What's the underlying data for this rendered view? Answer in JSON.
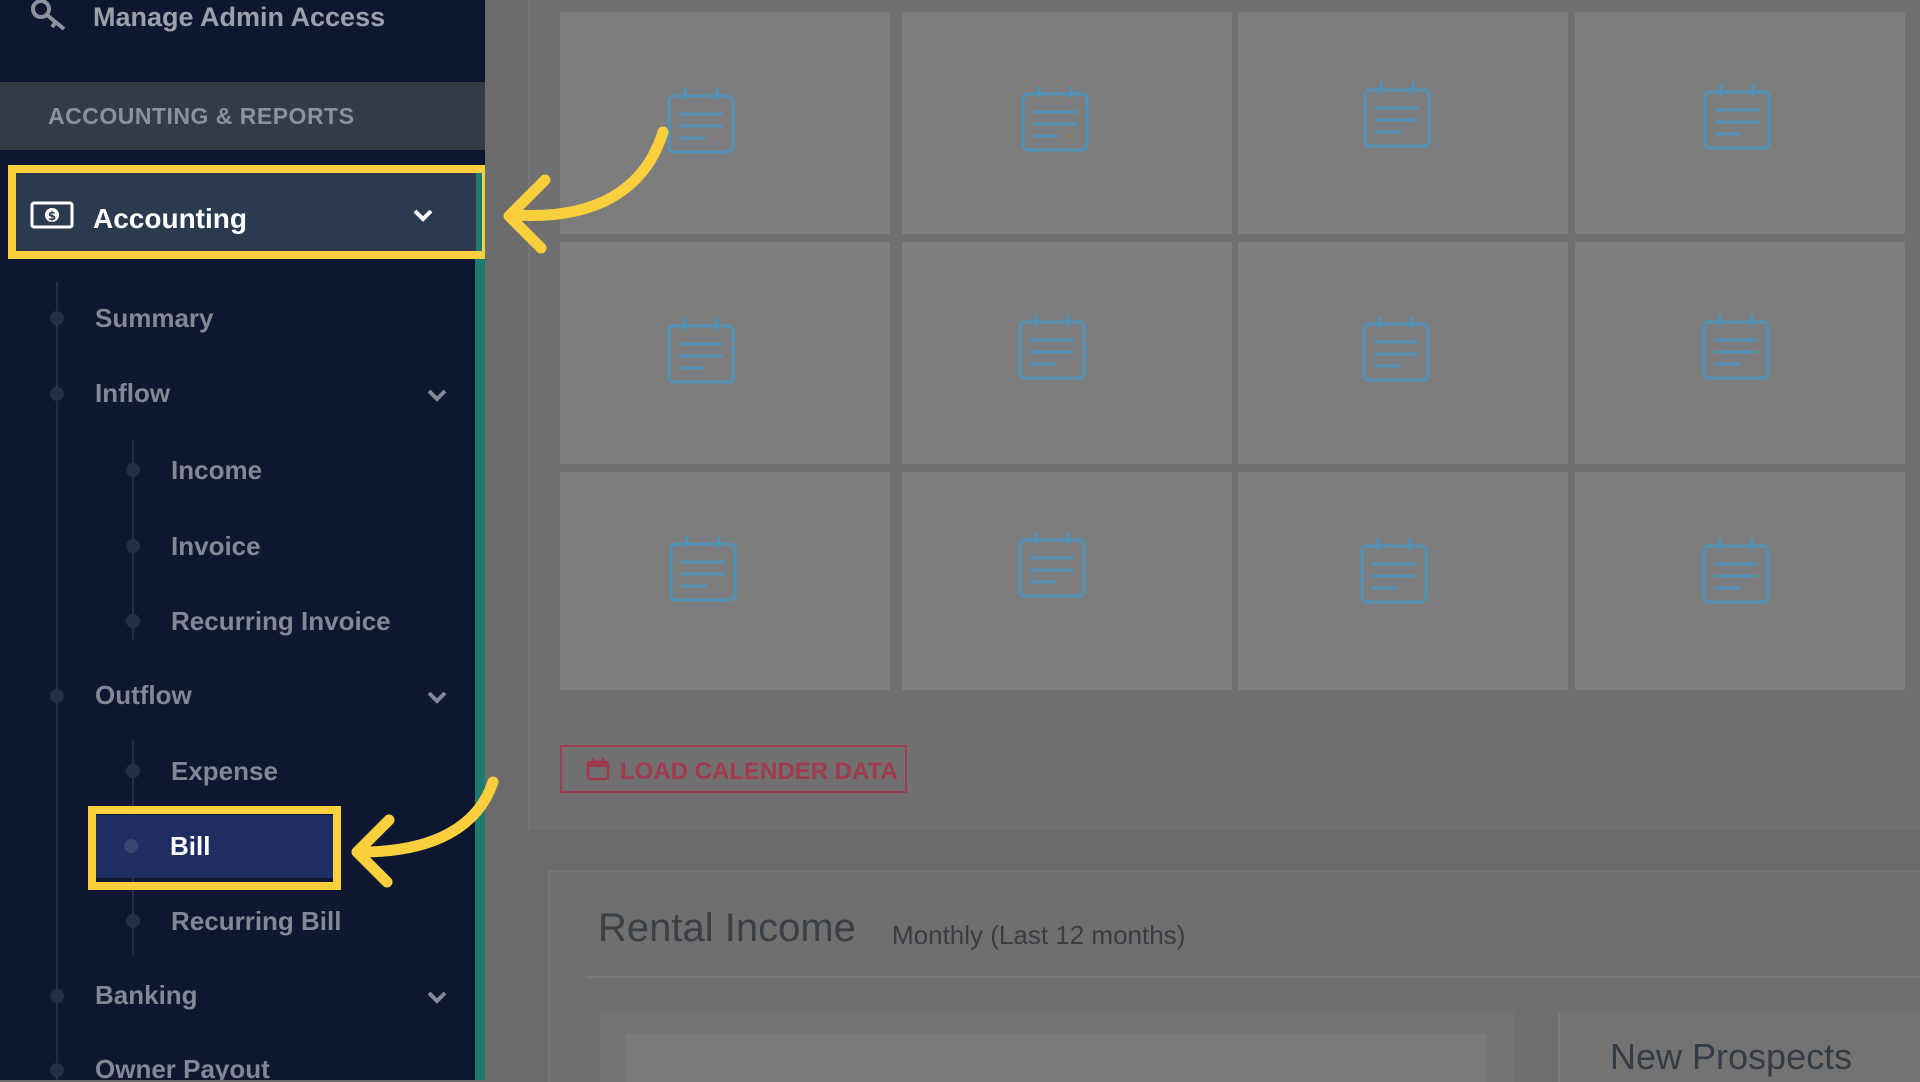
{
  "sidebar": {
    "admin_label": "Manage Admin Access",
    "section_header": "ACCOUNTING & REPORTS",
    "accounting_label": "Accounting",
    "items": {
      "summary": "Summary",
      "inflow": "Inflow",
      "income": "Income",
      "invoice": "Invoice",
      "recurring_invoice": "Recurring Invoice",
      "outflow": "Outflow",
      "expense": "Expense",
      "bill": "Bill",
      "recurring_bill": "Recurring Bill",
      "banking": "Banking",
      "owner_payout": "Owner Payout"
    }
  },
  "main": {
    "load_button_label": "LOAD CALENDER DATA",
    "rental_title": "Rental Income",
    "rental_subtitle": "Monthly (Last 12 months)",
    "prospects_title": "New Prospects"
  },
  "colors": {
    "sidebar_bg": "#0f1730",
    "highlight": "#f9cf3e",
    "active_item": "#1e2d62",
    "accent": "#1d7a6e"
  },
  "icons": {
    "admin": "key-icon",
    "accounting": "money-icon",
    "tiles": "notepad-icon",
    "load_button": "calendar-icon"
  }
}
